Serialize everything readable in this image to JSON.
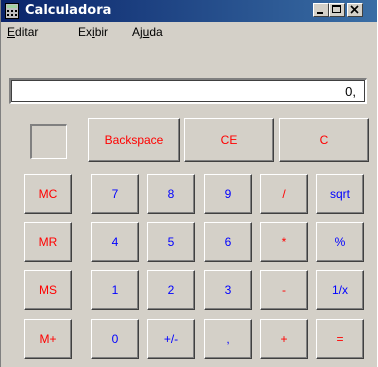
{
  "window": {
    "title": "Calculadora"
  },
  "menu": [
    {
      "pre": "",
      "u": "E",
      "post": "ditar"
    },
    {
      "pre": "Ex",
      "u": "i",
      "post": "bir"
    },
    {
      "pre": "Aj",
      "u": "u",
      "post": "da"
    }
  ],
  "display": {
    "value": "0,"
  },
  "colors": {
    "red": "#ff0000",
    "blue": "#0000ff",
    "face": "#d4d0c8",
    "title_start": "#0a246a",
    "title_end": "#3a6ea5"
  },
  "buttons": {
    "backspace": "Backspace",
    "ce": "CE",
    "c": "C",
    "mc": "MC",
    "mr": "MR",
    "ms": "MS",
    "mplus": "M+",
    "n7": "7",
    "n8": "8",
    "n9": "9",
    "divide": "/",
    "sqrt": "sqrt",
    "n4": "4",
    "n5": "5",
    "n6": "6",
    "multiply": "*",
    "percent": "%",
    "n1": "1",
    "n2": "2",
    "n3": "3",
    "minus": "-",
    "reciprocal": "1/x",
    "n0": "0",
    "sign": "+/-",
    "decimal": ",",
    "plus": "+",
    "equals": "="
  }
}
